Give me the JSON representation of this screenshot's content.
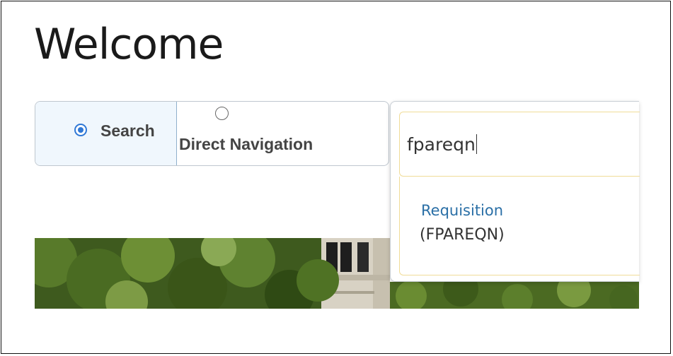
{
  "page": {
    "title": "Welcome"
  },
  "mode_toggle": {
    "search_label": "Search",
    "direct_label": "Direct Navigation",
    "selected": "Search"
  },
  "search": {
    "value": "fpareqn"
  },
  "results": [
    {
      "title": "Requisition",
      "code": "(FPAREQN)"
    }
  ],
  "colors": {
    "radio_accent": "#2f78d6",
    "result_link": "#2a6fa6",
    "input_focus_border": "#f0dc98"
  }
}
